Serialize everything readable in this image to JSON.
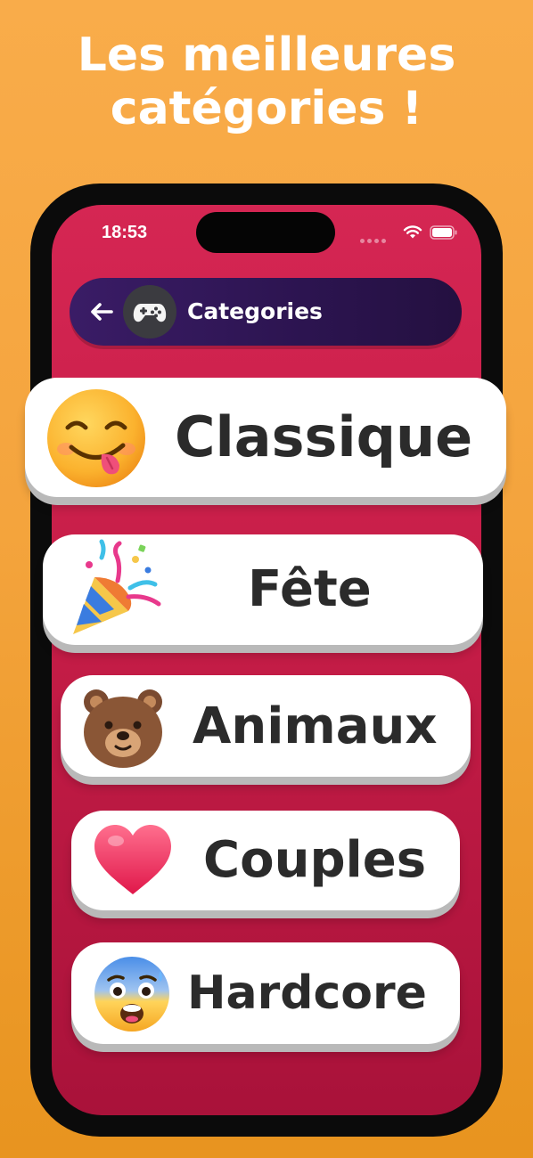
{
  "promo": {
    "headline_line1": "Les meilleures",
    "headline_line2": "catégories !"
  },
  "status_bar": {
    "time": "18:53"
  },
  "nav": {
    "title": "Categories",
    "back_icon": "arrow-left",
    "category_icon": "gamepad"
  },
  "categories": [
    {
      "label": "Classique",
      "icon": "tongue-smiley-emoji"
    },
    {
      "label": "Fête",
      "icon": "party-popper-emoji"
    },
    {
      "label": "Animaux",
      "icon": "bear-emoji"
    },
    {
      "label": "Couples",
      "icon": "heart-emoji"
    },
    {
      "label": "Hardcore",
      "icon": "anxious-face-emoji"
    }
  ],
  "colors": {
    "background": "#f4a43d",
    "screen": "#c61d47",
    "nav_bar": "#2c1450",
    "card": "#ffffff",
    "card_text": "#2b2b2b"
  }
}
